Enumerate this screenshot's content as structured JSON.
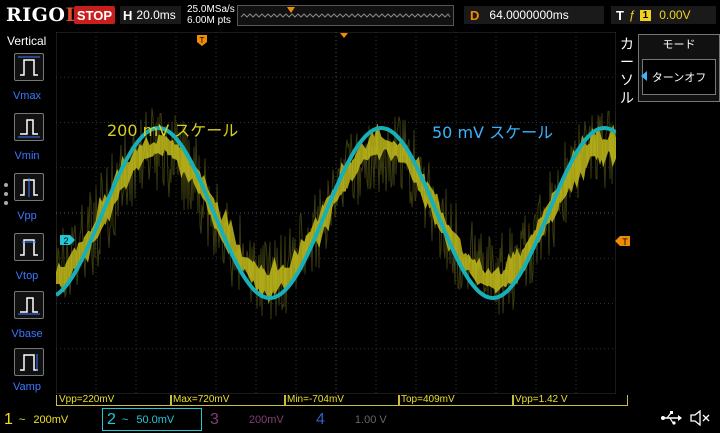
{
  "topbar": {
    "logo": "RIGOL",
    "run_state": "STOP",
    "timebase_letter": "H",
    "timebase_value": "20.0ms",
    "sample_rate": "25.0MSa/s",
    "memory_depth": "6.00M pts",
    "delay_letter": "D",
    "delay_value": "64.0000000ms",
    "trigger_letter": "T",
    "trigger_source": "1",
    "trigger_level": "0.00V"
  },
  "leftbar": {
    "title": "Vertical",
    "items": [
      {
        "label": "Vmax",
        "icon": "vmax-icon"
      },
      {
        "label": "Vmin",
        "icon": "vmin-icon"
      },
      {
        "label": "Vpp",
        "icon": "vpp-icon"
      },
      {
        "label": "Vtop",
        "icon": "vtop-icon"
      },
      {
        "label": "Vbase",
        "icon": "vbase-icon"
      },
      {
        "label": "Vamp",
        "icon": "vamp-icon"
      }
    ]
  },
  "rightbar": {
    "cursor_label": "カーソル",
    "menu_title": "モード",
    "menu_value": "ターンオフ"
  },
  "annotations": {
    "yellow_label": "200 mV スケール",
    "cyan_label": "50 mV スケール"
  },
  "markers": {
    "ch2_ref": "2",
    "trig_level": "T"
  },
  "measurements": [
    {
      "text": "Vpp=220mV"
    },
    {
      "text": "Max=720mV"
    },
    {
      "text": "Min=-704mV"
    },
    {
      "text": "Top=409mV"
    },
    {
      "text": "Vpp=1.42 V"
    }
  ],
  "channels": [
    {
      "num": "1",
      "coupling": "~",
      "scale": "200mV",
      "color": "#f0e21e",
      "active": true
    },
    {
      "num": "2",
      "coupling": "~",
      "scale": "50.0mV",
      "color": "#22c8d8",
      "active": true
    },
    {
      "num": "3",
      "coupling": "",
      "scale": "200mV",
      "color": "#a0408c",
      "active": false
    },
    {
      "num": "4",
      "coupling": "",
      "scale": "1.00 V",
      "color": "#3060c0",
      "active": false
    }
  ],
  "colors": {
    "ch1": "#d8d01e",
    "ch2": "#18b0b8",
    "accent_blue": "#3a78ff",
    "trigger_orange": "#f08c00"
  }
}
